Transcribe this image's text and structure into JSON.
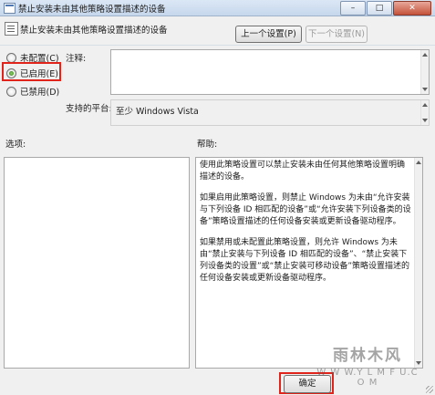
{
  "window": {
    "title": "禁止安装未由其他策略设置描述的设备",
    "buttons": {
      "minimize": "–",
      "maximize": "□",
      "close": "✕"
    }
  },
  "header": {
    "policy_name": "禁止安装未由其他策略设置描述的设备",
    "prev_setting": "上一个设置(P)",
    "next_setting": "下一个设置(N)"
  },
  "options": [
    {
      "label": "未配置(C)",
      "checked": false
    },
    {
      "label": "已启用(E)",
      "checked": true
    },
    {
      "label": "已禁用(D)",
      "checked": false
    }
  ],
  "comment_label": "注释:",
  "comment_value": "",
  "platform_label": "支持的平台:",
  "platform_value": "至少 Windows Vista",
  "options_section_label": "选项:",
  "help_section_label": "帮助:",
  "help": [
    "使用此策略设置可以禁止安装未由任何其他策略设置明确描述的设备。",
    "如果启用此策略设置，则禁止 Windows 为未由“允许安装与下列设备 ID 相匹配的设备”或“允许安装下列设备类的设备”策略设置描述的任何设备安装或更新设备驱动程序。",
    "如果禁用或未配置此策略设置，则允许 Windows 为未由“禁止安装与下列设备 ID 相匹配的设备”、“禁止安装下列设备类的设置”或“禁止安装可移动设备”策略设置描述的任何设备安装或更新设备驱动程序。"
  ],
  "footer": {
    "ok": "确定"
  },
  "watermark": {
    "main": "雨林木风",
    "sub": "W W W.Y L M F U.C O M"
  },
  "colors": {
    "highlight": "#e0231b",
    "selected_radio": "#2f7a16"
  }
}
